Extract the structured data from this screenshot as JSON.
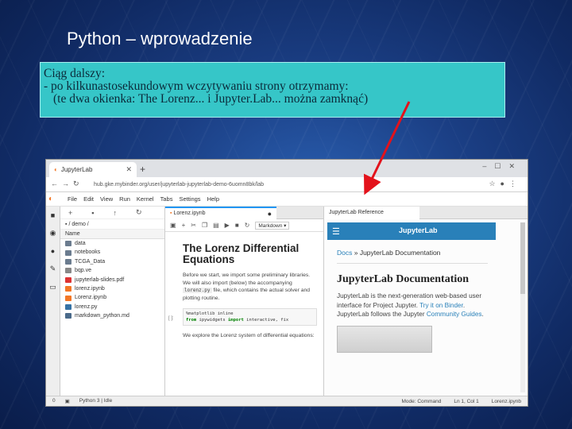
{
  "slide": {
    "title": "Python – wprowadzenie",
    "note_line1": "Ciąg dalszy:",
    "note_line2": "- po kilkunastosekundowym wczytywaniu strony otrzymamy:",
    "note_line3": "(te dwa okienka: The Lorenz... i Jupyter.Lab... można zamknąć)"
  },
  "browser": {
    "tab_title": "JupyterLab",
    "url": "hub.gke.mybinder.org/user/jupyterlab-jupyterlab-demo-6uomn8bk/lab",
    "menu": [
      "File",
      "Edit",
      "View",
      "Run",
      "Kernel",
      "Tabs",
      "Settings",
      "Help"
    ]
  },
  "filebrowser": {
    "path": "/ demo /",
    "column_header": "Name",
    "items": [
      {
        "name": "data",
        "type": "folder"
      },
      {
        "name": "notebooks",
        "type": "folder"
      },
      {
        "name": "TCGA_Data",
        "type": "folder"
      },
      {
        "name": "bqp.ve",
        "type": "file"
      },
      {
        "name": "jupyterlab-slides.pdf",
        "type": "pdf"
      },
      {
        "name": "lorenz.ipynb",
        "type": "notebook"
      },
      {
        "name": "Lorenz.ipynb",
        "type": "notebook"
      },
      {
        "name": "lorenz.py",
        "type": "python"
      },
      {
        "name": "markdown_python.md",
        "type": "markdown"
      }
    ]
  },
  "notebook": {
    "tab_label": "Lorenz.ipynb",
    "cell_type": "Markdown",
    "heading": "The Lorenz Differential Equations",
    "para1_a": "Before we start, we import some preliminary libraries. We will also import (below) the accompanying ",
    "para1_code": "lorenz.py",
    "para1_b": " file, which contains the actual solver and plotting routine.",
    "prompt": "[ ]:",
    "code_line1": "%matplotlib inline",
    "code_line2_a": "from",
    "code_line2_b": " ipywidgets ",
    "code_line2_c": "import",
    "code_line2_d": " interactive, fix",
    "para2": "We explore the Lorenz system of differential equations:"
  },
  "docs": {
    "tab_label": "JupyterLab Reference",
    "brand": "JupyterLab",
    "crumb_link": "Docs",
    "crumb_rest": " » JupyterLab Documentation",
    "heading": "JupyterLab Documentation",
    "para_a": "JupyterLab is the next-generation web-based user interface for Project Jupyter. ",
    "para_link1": "Try it on Binder",
    "para_b": ". JupyterLab follows the Jupyter ",
    "para_link2": "Community Guides",
    "para_c": "."
  },
  "status": {
    "count": "0",
    "kernel": "Python 3 | Idle",
    "mode": "Mode: Command",
    "position": "Ln 1, Col 1",
    "file": "Lorenz.ipynb"
  },
  "colors": {
    "note_bg": "#36c6c8",
    "arrow": "#e3121b",
    "jupyter_orange": "#f37726",
    "docs_blue": "#2980b9"
  }
}
